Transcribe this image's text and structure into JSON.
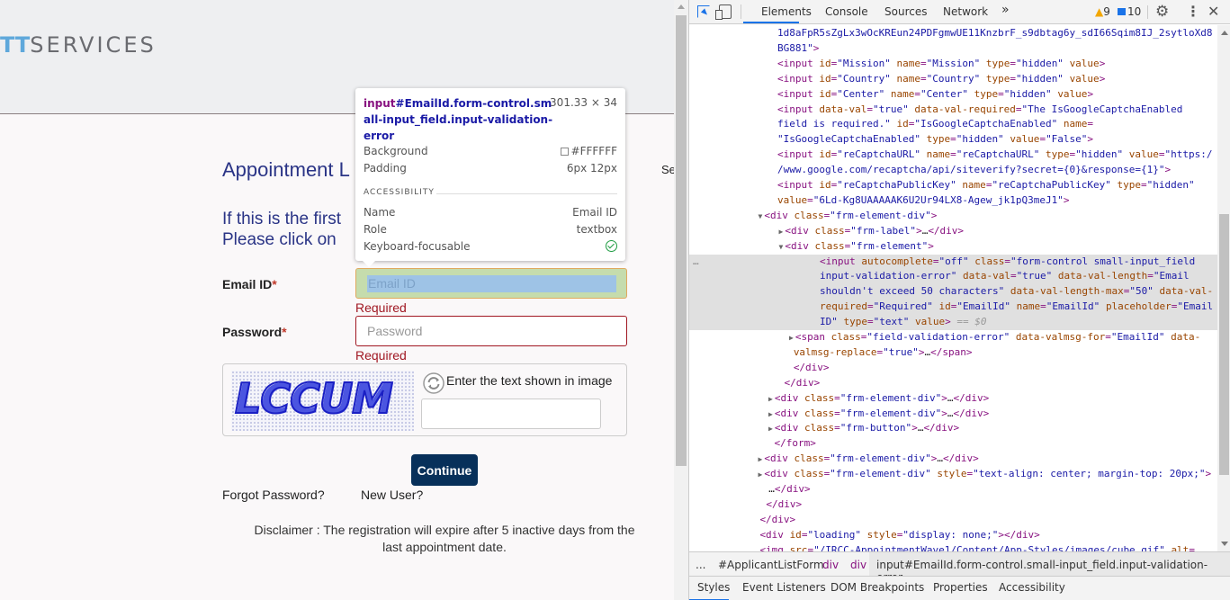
{
  "page": {
    "logo": {
      "accent": "TT",
      "rest": "SERVICES"
    },
    "title": "Appointment L",
    "side_text": "Se",
    "intro_line1": "If this is the first",
    "intro_line2": "Please click on",
    "email": {
      "label": "Email ID",
      "required_mark": "*",
      "placeholder": "Email ID",
      "value": "",
      "error": "Required"
    },
    "password": {
      "label": "Password",
      "required_mark": "*",
      "placeholder": "Password",
      "value": "",
      "error": "Required"
    },
    "captcha": {
      "image_text": "LCCUM",
      "prompt": "Enter the text shown in image",
      "value": ""
    },
    "continue_label": "Continue",
    "forgot_label": "Forgot Password?",
    "new_user_label": "New User?",
    "disclaimer": "Disclaimer : The registration will expire after 5 inactive days from the last appointment date."
  },
  "tooltip": {
    "tag": "input",
    "selector": "#EmailId.form-control.small-input_field.input-validation-error",
    "size": "301.33 × 34",
    "background_label": "Background",
    "background_value": "#FFFFFF",
    "padding_label": "Padding",
    "padding_value": "6px 12px",
    "accessibility_title": "ACCESSIBILITY",
    "name_label": "Name",
    "name_value": "Email ID",
    "role_label": "Role",
    "role_value": "textbox",
    "focusable_label": "Keyboard-focusable",
    "focusable": true
  },
  "devtools": {
    "tabs": [
      "Elements",
      "Console",
      "Sources",
      "Network"
    ],
    "active_tab": "Elements",
    "more_tabs": "»",
    "warnings": "9",
    "messages": "10",
    "dom_lines": [
      {
        "indent": 0,
        "parts": [
          [
            "av",
            "1d8aFpR5sZgLx3wOcKREun24PDFgmwUE11KnzbrF_s9dbtag6y_sdI66Sqim8IJ_2sytloXd8"
          ]
        ]
      },
      {
        "indent": 0,
        "parts": [
          [
            "av",
            "BG881\""
          ],
          [
            "tg",
            ">"
          ]
        ]
      },
      {
        "indent": 0,
        "parts": [
          [
            "tg",
            "<input "
          ],
          [
            "at",
            "id"
          ],
          [
            "tg",
            "="
          ],
          [
            "av",
            "\"Mission\" "
          ],
          [
            "at",
            "name"
          ],
          [
            "tg",
            "="
          ],
          [
            "av",
            "\"Mission\" "
          ],
          [
            "at",
            "type"
          ],
          [
            "tg",
            "="
          ],
          [
            "av",
            "\"hidden\" "
          ],
          [
            "at",
            "value"
          ],
          [
            "tg",
            ">"
          ]
        ]
      },
      {
        "indent": 0,
        "parts": [
          [
            "tg",
            "<input "
          ],
          [
            "at",
            "id"
          ],
          [
            "tg",
            "="
          ],
          [
            "av",
            "\"Country\" "
          ],
          [
            "at",
            "name"
          ],
          [
            "tg",
            "="
          ],
          [
            "av",
            "\"Country\" "
          ],
          [
            "at",
            "type"
          ],
          [
            "tg",
            "="
          ],
          [
            "av",
            "\"hidden\" "
          ],
          [
            "at",
            "value"
          ],
          [
            "tg",
            ">"
          ]
        ]
      },
      {
        "indent": 0,
        "parts": [
          [
            "tg",
            "<input "
          ],
          [
            "at",
            "id"
          ],
          [
            "tg",
            "="
          ],
          [
            "av",
            "\"Center\" "
          ],
          [
            "at",
            "name"
          ],
          [
            "tg",
            "="
          ],
          [
            "av",
            "\"Center\" "
          ],
          [
            "at",
            "type"
          ],
          [
            "tg",
            "="
          ],
          [
            "av",
            "\"hidden\" "
          ],
          [
            "at",
            "value"
          ],
          [
            "tg",
            ">"
          ]
        ]
      },
      {
        "indent": 0,
        "parts": [
          [
            "tg",
            "<input "
          ],
          [
            "at",
            "data-val"
          ],
          [
            "tg",
            "="
          ],
          [
            "av",
            "\"true\" "
          ],
          [
            "at",
            "data-val-required"
          ],
          [
            "tg",
            "="
          ],
          [
            "av",
            "\"The IsGoogleCaptchaEnabled"
          ]
        ]
      },
      {
        "indent": 0,
        "parts": [
          [
            "av",
            "field is required.\" "
          ],
          [
            "at",
            "id"
          ],
          [
            "tg",
            "="
          ],
          [
            "av",
            "\"IsGoogleCaptchaEnabled\" "
          ],
          [
            "at",
            "name"
          ],
          [
            "tg",
            "="
          ]
        ]
      },
      {
        "indent": 0,
        "parts": [
          [
            "av",
            "\"IsGoogleCaptchaEnabled\" "
          ],
          [
            "at",
            "type"
          ],
          [
            "tg",
            "="
          ],
          [
            "av",
            "\"hidden\" "
          ],
          [
            "at",
            "value"
          ],
          [
            "tg",
            "="
          ],
          [
            "av",
            "\"False\""
          ],
          [
            "tg",
            ">"
          ]
        ]
      },
      {
        "indent": 0,
        "parts": [
          [
            "tg",
            "<input "
          ],
          [
            "at",
            "id"
          ],
          [
            "tg",
            "="
          ],
          [
            "av",
            "\"reCaptchaURL\" "
          ],
          [
            "at",
            "name"
          ],
          [
            "tg",
            "="
          ],
          [
            "av",
            "\"reCaptchaURL\" "
          ],
          [
            "at",
            "type"
          ],
          [
            "tg",
            "="
          ],
          [
            "av",
            "\"hidden\" "
          ],
          [
            "at",
            "value"
          ],
          [
            "tg",
            "="
          ],
          [
            "av",
            "\"https:/"
          ]
        ]
      },
      {
        "indent": 0,
        "parts": [
          [
            "av",
            "/www.google.com/recaptcha/api/siteverify?secret={0}&response={1}\""
          ],
          [
            "tg",
            ">"
          ]
        ]
      },
      {
        "indent": 0,
        "parts": [
          [
            "tg",
            "<input "
          ],
          [
            "at",
            "id"
          ],
          [
            "tg",
            "="
          ],
          [
            "av",
            "\"reCaptchaPublicKey\" "
          ],
          [
            "at",
            "name"
          ],
          [
            "tg",
            "="
          ],
          [
            "av",
            "\"reCaptchaPublicKey\" "
          ],
          [
            "at",
            "type"
          ],
          [
            "tg",
            "="
          ],
          [
            "av",
            "\"hidden\""
          ]
        ]
      },
      {
        "indent": 0,
        "parts": [
          [
            "at",
            "value"
          ],
          [
            "tg",
            "="
          ],
          [
            "av",
            "\"6Ld-Kg8UAAAAAK6U2Ur94LX8-Agew_jk1pQ3meJ1\""
          ],
          [
            "tg",
            ">"
          ]
        ]
      },
      {
        "indent": -1,
        "arrow": "▼",
        "parts": [
          [
            "tg",
            "<div "
          ],
          [
            "at",
            "class"
          ],
          [
            "tg",
            "="
          ],
          [
            "av",
            "\"frm-element-div\""
          ],
          [
            "tg",
            ">"
          ]
        ]
      },
      {
        "indent": 1,
        "arrow": "▶",
        "parts": [
          [
            "tg",
            "<div "
          ],
          [
            "at",
            "class"
          ],
          [
            "tg",
            "="
          ],
          [
            "av",
            "\"frm-label\""
          ],
          [
            "tg",
            ">"
          ],
          [
            "tx",
            "…"
          ],
          [
            "tg",
            "</div>"
          ]
        ]
      },
      {
        "indent": 1,
        "arrow": "▼",
        "parts": [
          [
            "tg",
            "<div "
          ],
          [
            "at",
            "class"
          ],
          [
            "tg",
            "="
          ],
          [
            "av",
            "\"frm-element\""
          ],
          [
            "tg",
            ">"
          ]
        ]
      },
      {
        "indent": 2,
        "selected": true,
        "parts": [
          [
            "tg",
            "<input "
          ],
          [
            "at",
            "autocomplete"
          ],
          [
            "tg",
            "="
          ],
          [
            "av",
            "\"off\" "
          ],
          [
            "at",
            "class"
          ],
          [
            "tg",
            "="
          ],
          [
            "av",
            "\"form-control small-input_field"
          ]
        ]
      },
      {
        "indent": 2,
        "selected": true,
        "parts": [
          [
            "av",
            "input-validation-error\" "
          ],
          [
            "at",
            "data-val"
          ],
          [
            "tg",
            "="
          ],
          [
            "av",
            "\"true\" "
          ],
          [
            "at",
            "data-val-length"
          ],
          [
            "tg",
            "="
          ],
          [
            "av",
            "\"Email"
          ]
        ]
      },
      {
        "indent": 2,
        "selected": true,
        "parts": [
          [
            "av",
            "shouldn't exceed 50 characters\" "
          ],
          [
            "at",
            "data-val-length-max"
          ],
          [
            "tg",
            "="
          ],
          [
            "av",
            "\"50\" "
          ],
          [
            "at",
            "data-val-"
          ]
        ]
      },
      {
        "indent": 2,
        "selected": true,
        "parts": [
          [
            "at",
            "required"
          ],
          [
            "tg",
            "="
          ],
          [
            "av",
            "\"Required\" "
          ],
          [
            "at",
            "id"
          ],
          [
            "tg",
            "="
          ],
          [
            "av",
            "\"EmailId\" "
          ],
          [
            "at",
            "name"
          ],
          [
            "tg",
            "="
          ],
          [
            "av",
            "\"EmailId\" "
          ],
          [
            "at",
            "placeholder"
          ],
          [
            "tg",
            "="
          ],
          [
            "av",
            "\"Email"
          ]
        ]
      },
      {
        "indent": 2,
        "selected": true,
        "parts": [
          [
            "av",
            "ID\" "
          ],
          [
            "at",
            "type"
          ],
          [
            "tg",
            "="
          ],
          [
            "av",
            "\"text\" "
          ],
          [
            "at",
            "value"
          ],
          [
            "tg",
            "> "
          ],
          [
            "dim",
            "== $0"
          ]
        ]
      },
      {
        "indent": 2,
        "arrow": "▶",
        "parts": [
          [
            "tg",
            "<span "
          ],
          [
            "at",
            "class"
          ],
          [
            "tg",
            "="
          ],
          [
            "av",
            "\"field-validation-error\" "
          ],
          [
            "at",
            "data-valmsg-for"
          ],
          [
            "tg",
            "="
          ],
          [
            "av",
            "\"EmailId\" "
          ],
          [
            "at",
            "data-"
          ]
        ]
      },
      {
        "indent": 1.55,
        "parts": [
          [
            "at",
            "valmsg-replace"
          ],
          [
            "tg",
            "="
          ],
          [
            "av",
            "\"true\""
          ],
          [
            "tg",
            ">"
          ],
          [
            "tx",
            "…"
          ],
          [
            "tg",
            "</span>"
          ]
        ]
      },
      {
        "indent": 1.55,
        "parts": [
          [
            "tg",
            "</div>"
          ]
        ]
      },
      {
        "indent": 0.65,
        "parts": [
          [
            "tg",
            "</div>"
          ]
        ]
      },
      {
        "indent": 0,
        "arrow": "▶",
        "parts": [
          [
            "tg",
            "<div "
          ],
          [
            "at",
            "class"
          ],
          [
            "tg",
            "="
          ],
          [
            "av",
            "\"frm-element-div\""
          ],
          [
            "tg",
            ">"
          ],
          [
            "tx",
            "…"
          ],
          [
            "tg",
            "</div>"
          ]
        ]
      },
      {
        "indent": 0,
        "arrow": "▶",
        "parts": [
          [
            "tg",
            "<div "
          ],
          [
            "at",
            "class"
          ],
          [
            "tg",
            "="
          ],
          [
            "av",
            "\"frm-element-div\""
          ],
          [
            "tg",
            ">"
          ],
          [
            "tx",
            "…"
          ],
          [
            "tg",
            "</div>"
          ]
        ]
      },
      {
        "indent": 0,
        "arrow": "▶",
        "parts": [
          [
            "tg",
            "<div "
          ],
          [
            "at",
            "class"
          ],
          [
            "tg",
            "="
          ],
          [
            "av",
            "\"frm-button\""
          ],
          [
            "tg",
            ">"
          ],
          [
            "tx",
            "…"
          ],
          [
            "tg",
            "</div>"
          ]
        ]
      },
      {
        "indent": -0.3,
        "parts": [
          [
            "tg",
            "</form>"
          ]
        ]
      },
      {
        "indent": -1,
        "arrow": "▶",
        "parts": [
          [
            "tg",
            "<div "
          ],
          [
            "at",
            "class"
          ],
          [
            "tg",
            "="
          ],
          [
            "av",
            "\"frm-element-div\""
          ],
          [
            "tg",
            ">"
          ],
          [
            "tx",
            "…"
          ],
          [
            "tg",
            "</div>"
          ]
        ]
      },
      {
        "indent": -1,
        "arrow": "▶",
        "parts": [
          [
            "tg",
            "<div "
          ],
          [
            "at",
            "class"
          ],
          [
            "tg",
            "="
          ],
          [
            "av",
            "\"frm-element-div\" "
          ],
          [
            "at",
            "style"
          ],
          [
            "tg",
            "="
          ],
          [
            "av",
            "\"text-align: center; margin-top: 20px;\""
          ],
          [
            "tg",
            ">"
          ]
        ]
      },
      {
        "indent": -0.85,
        "parts": [
          [
            "tx",
            "…"
          ],
          [
            "tg",
            "</div>"
          ]
        ]
      },
      {
        "indent": -1.1,
        "parts": [
          [
            "tg",
            "</div>"
          ]
        ]
      },
      {
        "indent": -1.7,
        "parts": [
          [
            "tg",
            "</div>"
          ]
        ]
      },
      {
        "indent": -1.7,
        "parts": [
          [
            "tg",
            "<div "
          ],
          [
            "at",
            "id"
          ],
          [
            "tg",
            "="
          ],
          [
            "av",
            "\"loading\" "
          ],
          [
            "at",
            "style"
          ],
          [
            "tg",
            "="
          ],
          [
            "av",
            "\"display: none;\""
          ],
          [
            "tg",
            "></div>"
          ]
        ]
      },
      {
        "indent": -1.7,
        "parts": [
          [
            "tg",
            "<img "
          ],
          [
            "at",
            "src"
          ],
          [
            "tg",
            "="
          ],
          [
            "av",
            "\""
          ],
          [
            "lnk",
            "/IRCC-AppointmentWave1/Content/App-Styles/images/cube.gif"
          ],
          [
            "av",
            "\" "
          ],
          [
            "at",
            "alt"
          ],
          [
            "tg",
            "="
          ]
        ]
      }
    ],
    "breadcrumb": [
      "...",
      "#ApplicantListForm",
      "div",
      "div",
      "input#EmailId.form-control.small-input_field.input-validation-error"
    ],
    "subtabs": [
      "Styles",
      "Event Listeners",
      "DOM Breakpoints",
      "Properties",
      "Accessibility"
    ],
    "active_subtab": "Styles"
  }
}
